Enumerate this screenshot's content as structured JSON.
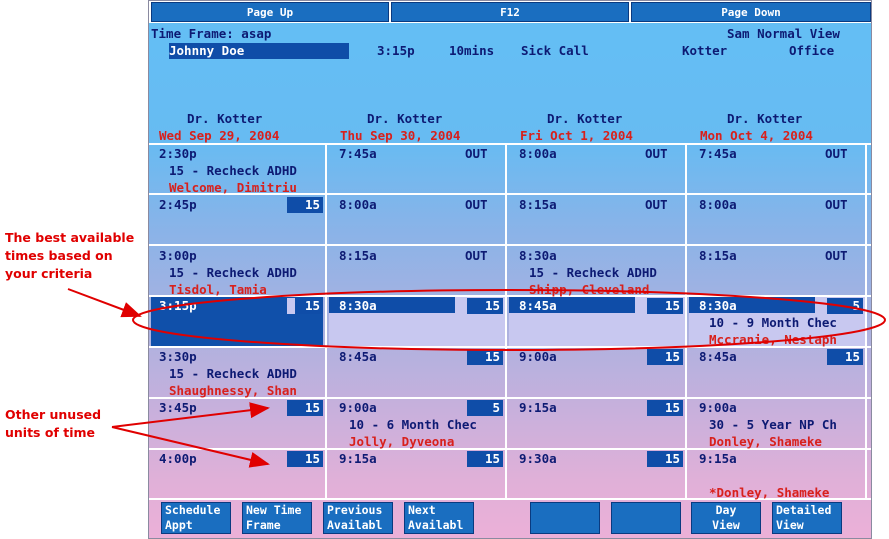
{
  "topbar": {
    "page_up": "Page Up",
    "f12": "F12",
    "page_down": "Page Down"
  },
  "header": {
    "timeframe": "Time Frame: asap",
    "view_name": "Sam Normal View",
    "patient": "Johnny Doe",
    "time": "3:15p",
    "duration": "10mins",
    "reason": "Sick Call",
    "provider": "Kotter",
    "location": "Office"
  },
  "columns": [
    {
      "doctor": "Dr. Kotter",
      "date": "Wed Sep 29, 2004"
    },
    {
      "doctor": "Dr. Kotter",
      "date": "Thu Sep 30, 2004"
    },
    {
      "doctor": "Dr. Kotter",
      "date": "Fri Oct  1, 2004"
    },
    {
      "doctor": "Dr. Kotter",
      "date": "Mon Oct  4, 2004"
    }
  ],
  "slots": {
    "c0": [
      {
        "time": "2:30p",
        "appt": "15 - Recheck ADHD",
        "patient": "Welcome, Dimitriu"
      },
      {
        "time": "2:45p",
        "units": "15"
      },
      {
        "time": "3:00p",
        "appt": "15 - Recheck ADHD",
        "patient": "Tisdol, Tamia"
      },
      {
        "time": "3:15p",
        "units": "15"
      },
      {
        "time": "3:30p",
        "appt": "15 - Recheck ADHD",
        "patient": "Shaughnessy, Shan"
      },
      {
        "time": "3:45p",
        "units": "15"
      },
      {
        "time": "4:00p",
        "units": "15"
      }
    ],
    "c1": [
      {
        "time": "7:45a",
        "status": "OUT"
      },
      {
        "time": "8:00a",
        "status": "OUT"
      },
      {
        "time": "8:15a",
        "status": "OUT"
      },
      {
        "time": "8:30a",
        "units": "15"
      },
      {
        "time": "8:45a",
        "units": "15"
      },
      {
        "time": "9:00a",
        "units": "5",
        "appt": "10 - 6 Month Chec",
        "patient": "Jolly, Dyveona"
      },
      {
        "time": "9:15a",
        "units": "15"
      }
    ],
    "c2": [
      {
        "time": "8:00a",
        "status": "OUT"
      },
      {
        "time": "8:15a",
        "status": "OUT"
      },
      {
        "time": "8:30a",
        "appt": "15 - Recheck ADHD",
        "patient": "Shipp, Cleveland"
      },
      {
        "time": "8:45a",
        "units": "15"
      },
      {
        "time": "9:00a",
        "units": "15"
      },
      {
        "time": "9:15a",
        "units": "15"
      },
      {
        "time": "9:30a",
        "units": "15"
      }
    ],
    "c3": [
      {
        "time": "7:45a",
        "status": "OUT"
      },
      {
        "time": "8:00a",
        "status": "OUT"
      },
      {
        "time": "8:15a",
        "status": "OUT"
      },
      {
        "time": "8:30a",
        "units": "5",
        "appt": "10 - 9 Month Chec",
        "patient": "Mccranie, Nestaph"
      },
      {
        "time": "8:45a",
        "units": "15"
      },
      {
        "time": "9:00a",
        "appt": "30 - 5 Year NP Ch",
        "patient": "Donley, Shameke"
      },
      {
        "time": "9:15a",
        "patient": "*Donley, Shameke"
      }
    ]
  },
  "bottom_buttons": [
    {
      "line1": "Schedule",
      "line2": "Appt"
    },
    {
      "line1": "New Time",
      "line2": "Frame"
    },
    {
      "line1": "Previous",
      "line2": "Availabl"
    },
    {
      "line1": "Next",
      "line2": "Availabl"
    },
    {
      "line1": "",
      "line2": ""
    },
    {
      "line1": "",
      "line2": ""
    },
    {
      "line1": "Day",
      "line2": "View"
    },
    {
      "line1": "Detailed",
      "line2": "View"
    }
  ],
  "annotations": {
    "best_line1": "The best available",
    "best_line2": "times based on",
    "best_line3": "your criteria",
    "other_line1": "Other unused",
    "other_line2": "units of time"
  },
  "colors": {
    "annotation": "#e00000",
    "navy_text": "#0d1a73",
    "red_text": "#d8201c",
    "highlight": "#0f4da8"
  }
}
